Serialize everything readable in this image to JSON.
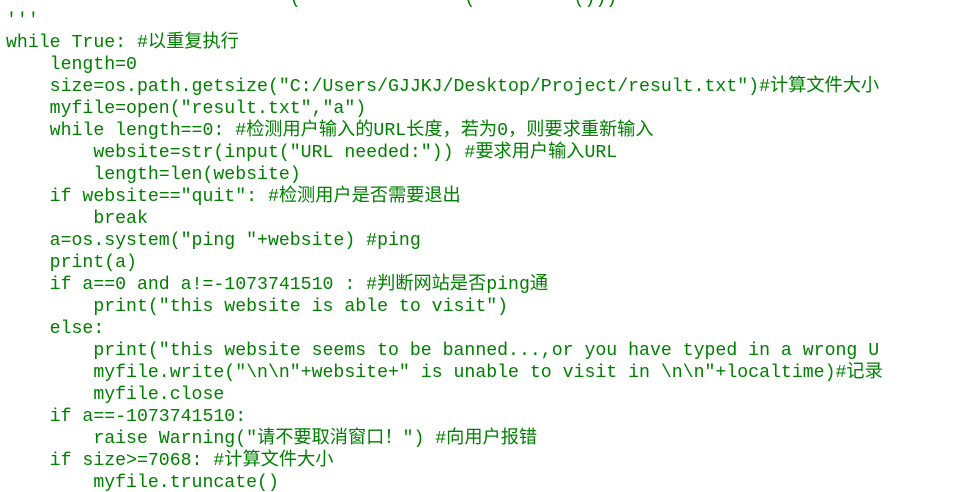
{
  "editor": {
    "text_color": "#008000",
    "background": "#ffffff",
    "lines": [
      "                          (               (         ()))",
      "'''",
      "while True: #以重复执行",
      "    length=0",
      "    size=os.path.getsize(\"C:/Users/GJJKJ/Desktop/Project/result.txt\")#计算文件大小",
      "    myfile=open(\"result.txt\",\"a\")",
      "    while length==0: #检测用户输入的URL长度，若为0，则要求重新输入",
      "        website=str(input(\"URL needed:\")) #要求用户输入URL",
      "        length=len(website)",
      "    if website==\"quit\": #检测用户是否需要退出",
      "        break",
      "    a=os.system(\"ping \"+website) #ping",
      "    print(a)",
      "    if a==0 and a!=-1073741510 : #判断网站是否ping通",
      "        print(\"this website is able to visit\")",
      "    else:",
      "        print(\"this website seems to be banned...,or you have typed in a wrong U",
      "        myfile.write(\"\\n\\n\"+website+\" is unable to visit in \\n\\n\"+localtime)#记录",
      "        myfile.close",
      "    if a==-1073741510:",
      "        raise Warning(\"请不要取消窗口！\") #向用户报错",
      "    if size>=7068: #计算文件大小",
      "        myfile.truncate()"
    ]
  }
}
